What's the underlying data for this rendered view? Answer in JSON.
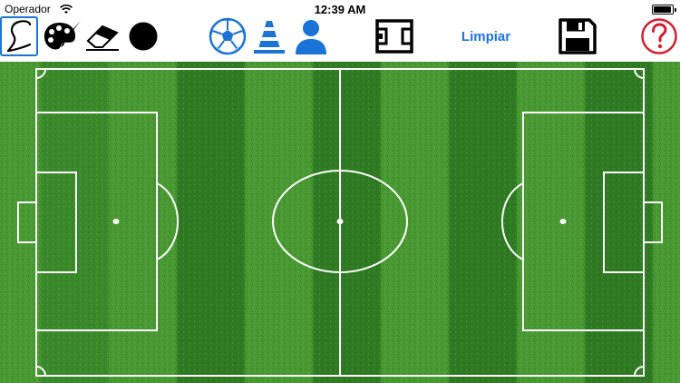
{
  "status_bar": {
    "carrier": "Operador",
    "time": "12:39 AM"
  },
  "toolbar": {
    "tools": [
      {
        "name": "freehand-draw-tool",
        "icon": "freehand-line-icon",
        "selected": true
      },
      {
        "name": "palette-tool",
        "icon": "paint-palette-icon"
      },
      {
        "name": "eraser-tool",
        "icon": "eraser-icon"
      },
      {
        "name": "color-swatch",
        "icon": "black-circle-icon"
      },
      {
        "name": "add-ball-tool",
        "icon": "soccer-ball-icon"
      },
      {
        "name": "add-cone-tool",
        "icon": "traffic-cone-icon"
      },
      {
        "name": "add-player-tool",
        "icon": "person-icon"
      },
      {
        "name": "field-layout-tool",
        "icon": "pitch-layout-icon"
      },
      {
        "name": "save-tool",
        "icon": "floppy-disk-icon"
      },
      {
        "name": "help-tool",
        "icon": "question-circle-icon"
      }
    ],
    "clear_label": "Limpiar"
  },
  "colors": {
    "accent_blue": "#1b73d6",
    "help_red": "#d01f2f",
    "grass_dark": "#2f7a23",
    "grass_light": "#4a9a33",
    "line_white": "#ffffff"
  }
}
